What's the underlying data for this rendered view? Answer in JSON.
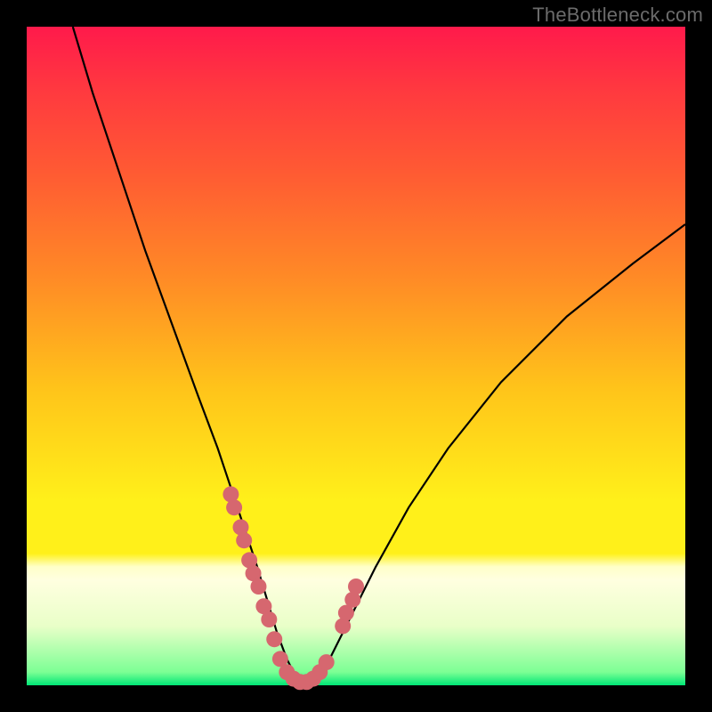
{
  "watermark": "TheBottleneck.com",
  "colors": {
    "background": "#000000",
    "curve": "#000000",
    "marker": "#d6676f",
    "gradient_stops": [
      "#ff1a4b",
      "#ff3a3f",
      "#ff5a33",
      "#ff8a26",
      "#ffc41a",
      "#fff01a",
      "#ffffc8",
      "#ffffe0",
      "#e9ffc8",
      "#7cff94",
      "#00e676"
    ]
  },
  "chart_data": {
    "type": "line",
    "title": "",
    "xlabel": "",
    "ylabel": "",
    "xlim": [
      0,
      100
    ],
    "ylim": [
      0,
      100
    ],
    "series": [
      {
        "name": "curve",
        "x": [
          7,
          10,
          14,
          18,
          22,
          26,
          29,
          31,
          33,
          35,
          36.5,
          38,
          39.5,
          41,
          42.5,
          44,
          46,
          49,
          53,
          58,
          64,
          72,
          82,
          92,
          100
        ],
        "y": [
          100,
          90,
          78,
          66,
          55,
          44,
          36,
          30,
          24,
          18,
          13,
          8,
          4,
          1,
          0,
          1,
          4,
          10,
          18,
          27,
          36,
          46,
          56,
          64,
          70
        ]
      }
    ],
    "markers": {
      "left_arm": [
        {
          "x": 31,
          "y": 29
        },
        {
          "x": 31.5,
          "y": 27
        },
        {
          "x": 32.5,
          "y": 24
        },
        {
          "x": 33,
          "y": 22
        },
        {
          "x": 33.8,
          "y": 19
        },
        {
          "x": 34.4,
          "y": 17
        },
        {
          "x": 35.2,
          "y": 15
        },
        {
          "x": 36.0,
          "y": 12
        },
        {
          "x": 36.8,
          "y": 10
        },
        {
          "x": 37.6,
          "y": 7
        },
        {
          "x": 38.5,
          "y": 4
        }
      ],
      "bottom": [
        {
          "x": 39.5,
          "y": 2
        },
        {
          "x": 40.5,
          "y": 1
        },
        {
          "x": 41.5,
          "y": 0.5
        },
        {
          "x": 42.5,
          "y": 0.5
        },
        {
          "x": 43.5,
          "y": 1
        },
        {
          "x": 44.5,
          "y": 2
        },
        {
          "x": 45.5,
          "y": 3.5
        }
      ],
      "right_arm": [
        {
          "x": 48,
          "y": 9
        },
        {
          "x": 48.5,
          "y": 11
        },
        {
          "x": 49.5,
          "y": 13
        },
        {
          "x": 50,
          "y": 15
        }
      ]
    }
  }
}
